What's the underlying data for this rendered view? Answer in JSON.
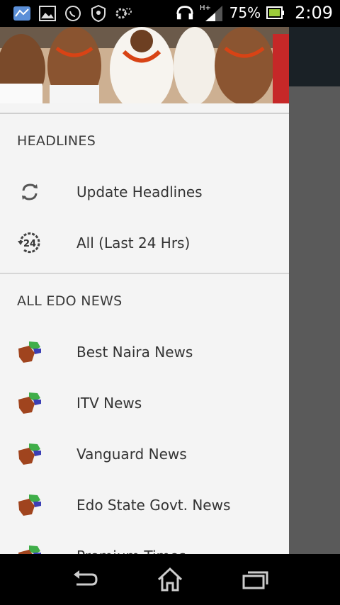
{
  "status_bar": {
    "battery_percent": "75%",
    "time": "2:09",
    "network_label": "H+",
    "left_icons": [
      "maps-icon",
      "gallery-icon",
      "whatsapp-icon",
      "shield-icon",
      "settings-sync-icon"
    ],
    "right_icons": [
      "headset-alarm-icon",
      "signal-icon",
      "battery-icon"
    ]
  },
  "drawer": {
    "headlines_section": {
      "title": "HEADLINES",
      "items": [
        {
          "label": "Update Headlines",
          "icon": "refresh-icon"
        },
        {
          "label": "All (Last 24 Hrs)",
          "icon": "history-24-icon"
        }
      ]
    },
    "news_section": {
      "title": "ALL EDO NEWS",
      "items": [
        {
          "label": "Best Naira News",
          "icon": "edo-map-icon"
        },
        {
          "label": "ITV News",
          "icon": "edo-map-icon"
        },
        {
          "label": "Vanguard News",
          "icon": "edo-map-icon"
        },
        {
          "label": "Edo State Govt. News",
          "icon": "edo-map-icon"
        },
        {
          "label": "Premium Times",
          "icon": "edo-map-icon"
        }
      ]
    }
  },
  "colors": {
    "drawer_bg": "#f4f4f4",
    "scrim": "#5a5a5a",
    "action_bar": "#1a2126",
    "text": "#333333"
  },
  "nav_bar": {
    "buttons": [
      "back-icon",
      "home-icon",
      "recents-icon"
    ]
  }
}
